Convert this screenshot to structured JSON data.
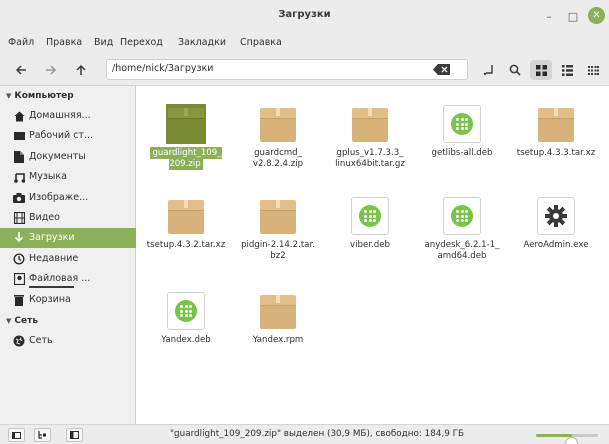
{
  "window": {
    "title": "Загрузки",
    "minimize": "–",
    "maximize": "□",
    "close": "✕"
  },
  "menu": [
    "Файл",
    "Правка",
    "Вид",
    "Переход",
    "Закладки",
    "Справка"
  ],
  "toolbar": {
    "path": "/home/nick/Загрузки",
    "view": "icons"
  },
  "sidebar": {
    "computer_header": "Компьютер",
    "items": [
      {
        "label": "Домашняя...",
        "icon": "home-icon"
      },
      {
        "label": "Рабочий ст...",
        "icon": "desktop-icon"
      },
      {
        "label": "Документы",
        "icon": "documents-icon"
      },
      {
        "label": "Музыка",
        "icon": "music-icon"
      },
      {
        "label": "Изображе...",
        "icon": "camera-icon"
      },
      {
        "label": "Видео",
        "icon": "video-icon"
      },
      {
        "label": "Загрузки",
        "icon": "download-icon",
        "selected": true
      },
      {
        "label": "Недавние",
        "icon": "recent-icon"
      },
      {
        "label": "Файловая ...",
        "icon": "drive-icon",
        "usage_bar": true
      },
      {
        "label": "Корзина",
        "icon": "trash-icon"
      }
    ],
    "network_header": "Сеть",
    "network_items": [
      {
        "label": "Сеть",
        "icon": "network-icon"
      }
    ]
  },
  "files": [
    {
      "name": "guardlight_109_\n209.zip",
      "type": "archive",
      "selected": true
    },
    {
      "name": "guardcmd_\nv2.8.2.4.zip",
      "type": "archive"
    },
    {
      "name": "gplus_v1.7.3.3_\nlinux64bit.tar.gz",
      "type": "archive"
    },
    {
      "name": "getlibs-all.deb",
      "type": "deb"
    },
    {
      "name": "tsetup.4.3.3.tar.xz",
      "type": "archive"
    },
    {
      "name": "tsetup.4.3.2.tar.xz",
      "type": "archive"
    },
    {
      "name": "pidgin-2.14.2.tar.\nbz2",
      "type": "archive"
    },
    {
      "name": "viber.deb",
      "type": "deb"
    },
    {
      "name": "anydesk_6.2.1-1_\namd64.deb",
      "type": "deb"
    },
    {
      "name": "AeroAdmin.exe",
      "type": "exe"
    },
    {
      "name": "Yandex.deb",
      "type": "deb"
    },
    {
      "name": "Yandex.rpm",
      "type": "archive"
    }
  ],
  "status": {
    "text": "\"guardlight_109_209.zip\" выделен (30,9 МБ), свободно: 184,9 ГБ",
    "zoom_level": 0.58
  },
  "colors": {
    "accent": "#8bb158",
    "selected_icon": "#7a8a35",
    "archive": "#d8b27b",
    "deb": "#79c34b"
  }
}
